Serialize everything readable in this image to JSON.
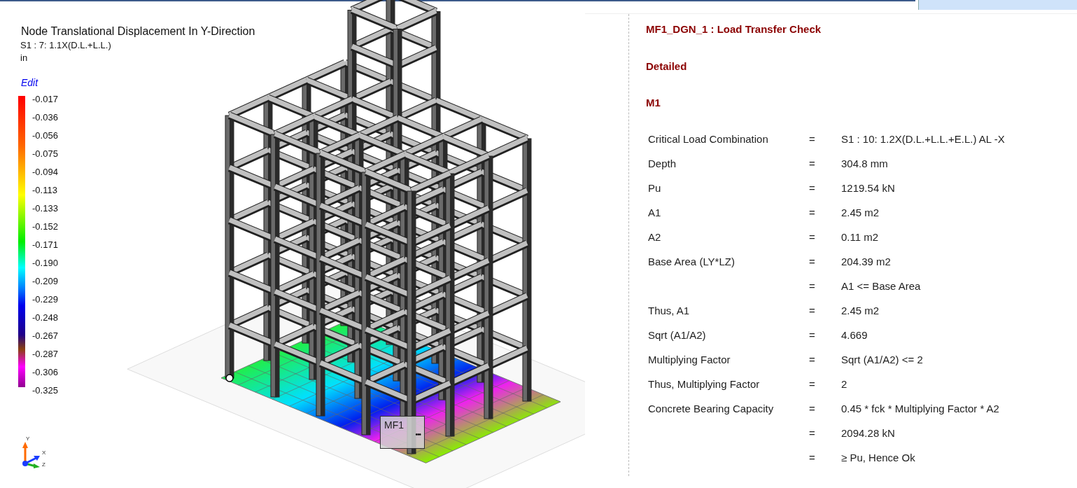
{
  "viewport": {
    "title": "Node Translational Displacement In Y-Direction",
    "load_case": "S1 : 7: 1.1X(D.L.+L.L.)",
    "unit": "in",
    "edit_link": "Edit",
    "legend": [
      "-0.017",
      "-0.036",
      "-0.056",
      "-0.075",
      "-0.094",
      "-0.113",
      "-0.133",
      "-0.152",
      "-0.171",
      "-0.190",
      "-0.209",
      "-0.229",
      "-0.248",
      "-0.267",
      "-0.287",
      "-0.306",
      "-0.325"
    ],
    "axes": [
      "Y",
      "X",
      "Z"
    ],
    "tooltip": {
      "label": "MF1",
      "more": "•••"
    }
  },
  "report": {
    "title": "MF1_DGN_1 : Load Transfer Check",
    "section": "Detailed",
    "member": "M1",
    "rows": [
      {
        "label": "Critical Load Combination",
        "sign": "=",
        "value": "S1 : 10: 1.2X(D.L.+L.L.+E.L.) AL -X"
      },
      {
        "label": "Depth",
        "sign": "=",
        "value": "304.8 mm"
      },
      {
        "label": "Pu",
        "sign": "=",
        "value": "1219.54 kN"
      },
      {
        "label": "A1",
        "sign": "=",
        "value": "2.45 m2"
      },
      {
        "label": "A2",
        "sign": "=",
        "value": "0.11 m2"
      },
      {
        "label": "Base Area (LY*LZ)",
        "sign": "=",
        "value": "204.39 m2"
      },
      {
        "sign": "=",
        "value": "A1 <= Base Area"
      },
      {
        "label": "Thus, A1",
        "sign": "=",
        "value": "2.45 m2"
      },
      {
        "label": "Sqrt (A1/A2)",
        "sign": "=",
        "value": "4.669"
      },
      {
        "label": "Multiplying Factor",
        "sign": "=",
        "value": "Sqrt (A1/A2) <= 2"
      },
      {
        "label": "Thus, Multiplying Factor",
        "sign": "=",
        "value": "2"
      },
      {
        "label": "Concrete Bearing Capacity",
        "sign": "=",
        "value": "0.45 * fck * Multiplying Factor * A2"
      },
      {
        "sign": "=",
        "value": "2094.28 kN"
      },
      {
        "sign": "=",
        "value": "≥ Pu, Hence Ok"
      }
    ]
  }
}
